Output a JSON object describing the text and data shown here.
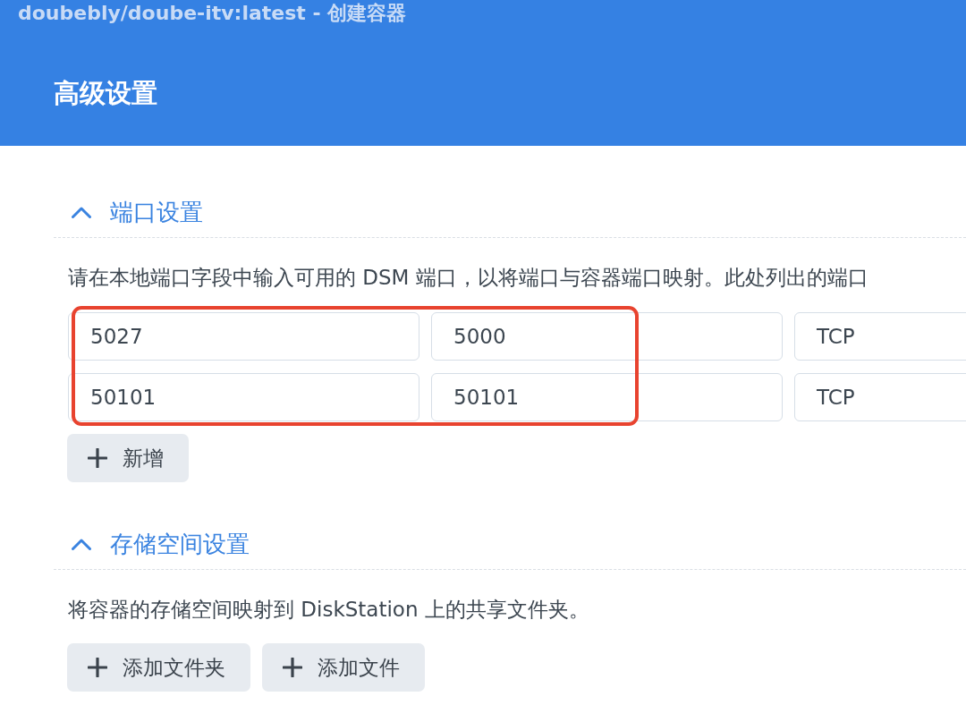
{
  "window": {
    "title": "doubebly/doube-itv:latest - 创建容器"
  },
  "page_title": "高级设置",
  "sections": [
    {
      "title": "端口设置",
      "expanded": true,
      "description": "请在本地端口字段中输入可用的 DSM 端口，以将端口与容器端口映射。此处列出的端口",
      "highlighted": true,
      "rows": [
        {
          "column_1": "5027",
          "column_2": "5000",
          "column_3": "TCP"
        },
        {
          "column_1": "50101",
          "column_2": "50101",
          "column_3": "TCP"
        }
      ],
      "buttons": [
        "新增"
      ]
    },
    {
      "title": "存储空间设置",
      "expanded": true,
      "description": "将容器的存储空间映射到 DiskStation 上的共享文件夹。",
      "buttons": [
        "添加文件夹",
        "添加文件"
      ]
    }
  ]
}
